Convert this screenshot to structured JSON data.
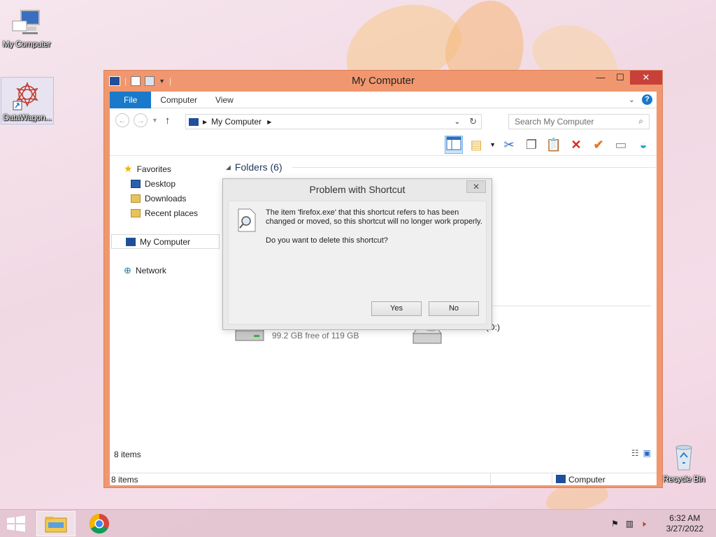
{
  "desktop": {
    "icons": [
      {
        "label": "My Computer",
        "icon": "computer-icon"
      },
      {
        "label": "DataWagon...",
        "icon": "datawagon-shortcut-icon"
      },
      {
        "label": "Recycle Bin",
        "icon": "recycle-bin-icon"
      }
    ]
  },
  "window": {
    "title": "My Computer",
    "tabs": [
      "File",
      "Computer",
      "View"
    ],
    "address": {
      "crumb": "My Computer"
    },
    "search": {
      "placeholder": "Search My Computer"
    },
    "nav": {
      "favorites": "Favorites",
      "items": [
        "Desktop",
        "Downloads",
        "Recent places"
      ],
      "my_computer": "My Computer",
      "network": "Network"
    },
    "group": {
      "label": "Folders (6)"
    },
    "drives": [
      {
        "name": "",
        "free_text": "99.2 GB free of 119 GB",
        "used_fraction": 0.17
      },
      {
        "name": "CD Drive (D:)"
      }
    ],
    "status": {
      "items_top": "8 items",
      "items_bottom": "8 items",
      "location": "Computer"
    }
  },
  "dialog": {
    "title": "Problem with Shortcut",
    "message": "The item 'firefox.exe' that this shortcut refers to has been changed or moved, so this shortcut will no longer work properly.",
    "question": "Do you want to delete this shortcut?",
    "yes": "Yes",
    "no": "No"
  },
  "taskbar": {
    "time": "6:32 AM",
    "date": "3/27/2022"
  },
  "colors": {
    "accent": "#1979ca",
    "window_frame": "#f0976f",
    "close": "#c7403a"
  }
}
